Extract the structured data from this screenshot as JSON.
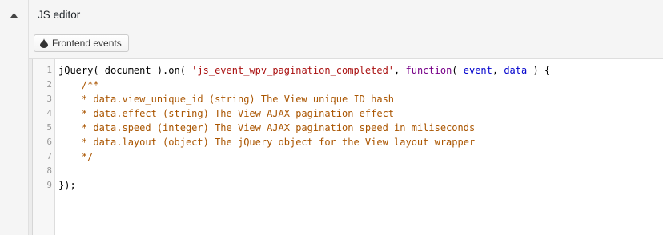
{
  "panel": {
    "title": "JS editor",
    "collapse_icon": "triangle-up-icon"
  },
  "toolbar": {
    "frontend_events_label": "Frontend events",
    "frontend_events_icon": "drop-icon"
  },
  "editor": {
    "line_numbers": [
      "1",
      "2",
      "3",
      "4",
      "5",
      "6",
      "7",
      "8",
      "9"
    ],
    "lines": [
      [
        {
          "t": "jQuery( document ).on( ",
          "c": "plain"
        },
        {
          "t": "'js_event_wpv_pagination_completed'",
          "c": "string"
        },
        {
          "t": ", ",
          "c": "plain"
        },
        {
          "t": "function",
          "c": "keyword"
        },
        {
          "t": "( ",
          "c": "plain"
        },
        {
          "t": "event",
          "c": "var"
        },
        {
          "t": ", ",
          "c": "plain"
        },
        {
          "t": "data",
          "c": "var"
        },
        {
          "t": " ) {",
          "c": "plain"
        }
      ],
      [
        {
          "t": "    /**",
          "c": "comment"
        }
      ],
      [
        {
          "t": "    * data.view_unique_id (string) The View unique ID hash",
          "c": "comment"
        }
      ],
      [
        {
          "t": "    * data.effect (string) The View AJAX pagination effect",
          "c": "comment"
        }
      ],
      [
        {
          "t": "    * data.speed (integer) The View AJAX pagination speed in miliseconds",
          "c": "comment"
        }
      ],
      [
        {
          "t": "    * data.layout (object) The jQuery object for the View layout wrapper",
          "c": "comment"
        }
      ],
      [
        {
          "t": "    */",
          "c": "comment"
        }
      ],
      [
        {
          "t": "",
          "c": "plain"
        }
      ],
      [
        {
          "t": "});",
          "c": "plain"
        }
      ]
    ]
  },
  "colors": {
    "string": "#aa1111",
    "keyword": "#770088",
    "variable": "#0000cc",
    "comment": "#aa5500",
    "line_number": "#999999"
  }
}
